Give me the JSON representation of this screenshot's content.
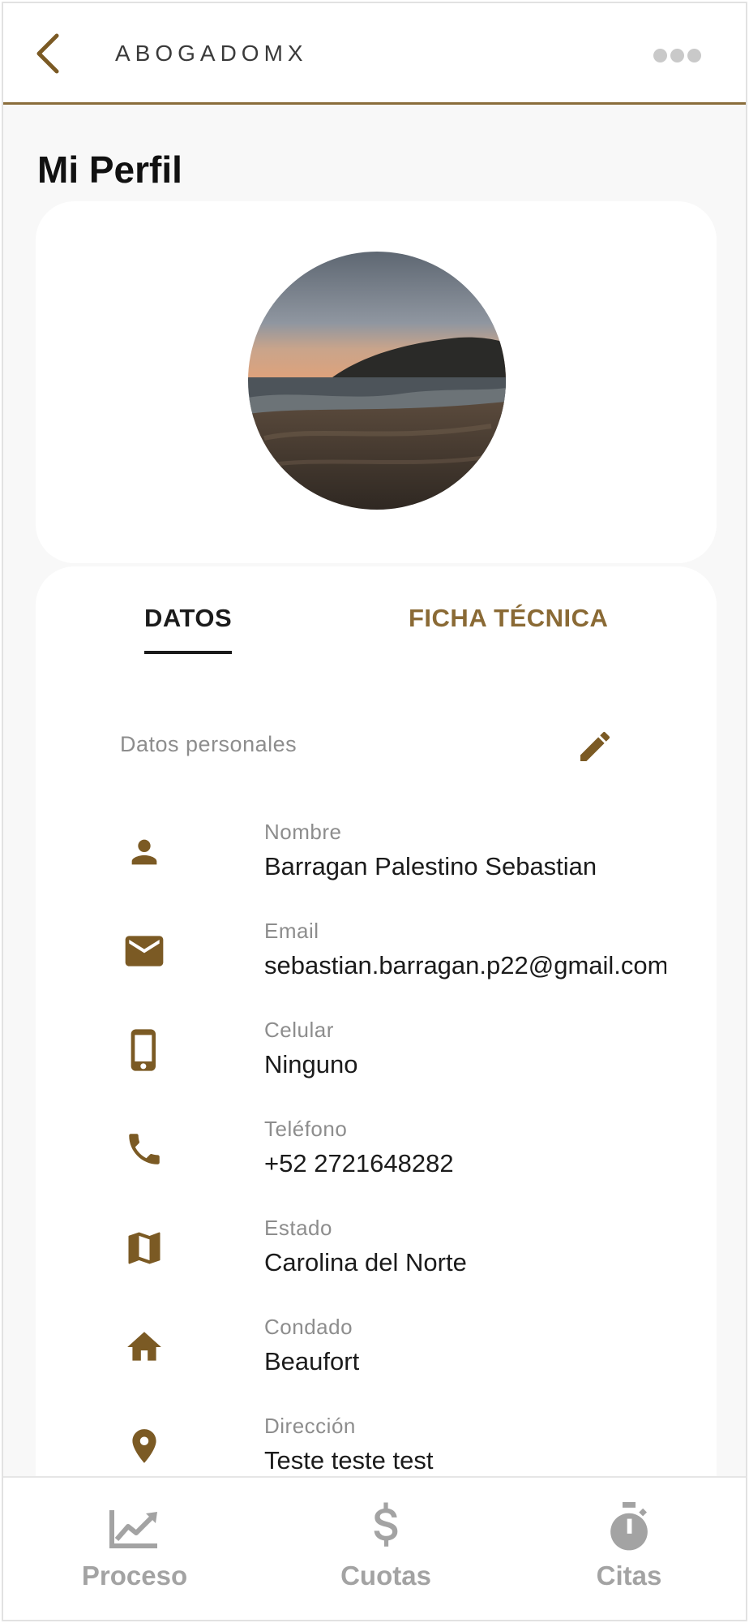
{
  "header": {
    "brand": "ABOGADOMX",
    "back_icon": "chevron-left-icon",
    "more_icon": "more-horizontal-icon"
  },
  "page": {
    "title": "Mi Perfil"
  },
  "profile": {
    "avatar_alt": "beach-sunset-avatar"
  },
  "tabs": [
    {
      "label": "DATOS",
      "active": true
    },
    {
      "label": "FICHA TÉCNICA",
      "active": false
    }
  ],
  "section": {
    "label": "Datos personales",
    "edit_icon": "pencil-icon"
  },
  "fields": [
    {
      "icon": "person-icon",
      "label": "Nombre",
      "value": "Barragan Palestino Sebastian"
    },
    {
      "icon": "mail-icon",
      "label": "Email",
      "value": "sebastian.barragan.p22@gmail.com"
    },
    {
      "icon": "smartphone-icon",
      "label": "Celular",
      "value": "Ninguno"
    },
    {
      "icon": "phone-icon",
      "label": "Teléfono",
      "value": "+52 2721648282"
    },
    {
      "icon": "map-icon",
      "label": "Estado",
      "value": "Carolina del Norte"
    },
    {
      "icon": "home-icon",
      "label": "Condado",
      "value": "Beaufort"
    },
    {
      "icon": "location-pin-icon",
      "label": "Dirección",
      "value": "Teste teste test"
    }
  ],
  "bottom_nav": [
    {
      "icon": "trending-up-icon",
      "label": "Proceso"
    },
    {
      "icon": "dollar-icon",
      "label": "Cuotas"
    },
    {
      "icon": "stopwatch-icon",
      "label": "Citas"
    }
  ],
  "colors": {
    "accent": "#8a6a35",
    "icon_brown": "#7b5a24",
    "header_border": "#8a6d3b",
    "muted_text": "#8d8d8d",
    "nav_inactive": "#a3a3a3"
  }
}
